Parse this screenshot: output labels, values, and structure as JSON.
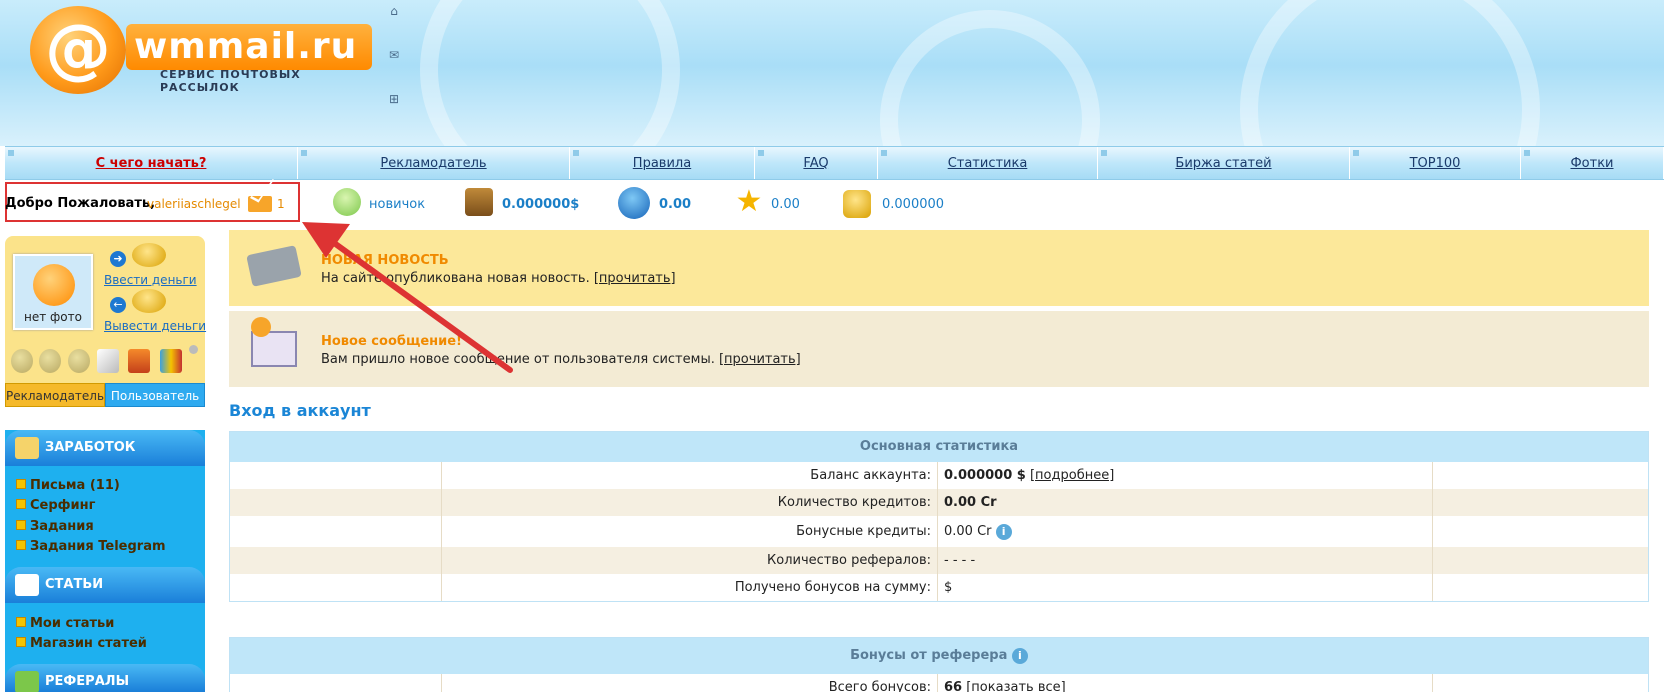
{
  "logo": {
    "at": "@",
    "name": "wmmail.ru",
    "tagline": "СЕРВИС ПОЧТОВЫХ РАССЫЛОК"
  },
  "header_icons": [
    "home-icon",
    "mail-icon",
    "sitemap-icon"
  ],
  "nav": [
    "С чего начать?",
    "Рекламодатель",
    "Правила",
    "FAQ",
    "Статистика",
    "Биржа статей",
    "TOP100",
    "Фотки"
  ],
  "welcome": {
    "text": "Добро Пожаловать,",
    "username": "valeriiaschlegel",
    "messages": "1"
  },
  "stats": {
    "status": "новичок",
    "balance": "0.000000$",
    "credits": "0.00",
    "rating": "0.00",
    "coins": "0.000000"
  },
  "profile": {
    "photo_label": "нет фото",
    "deposit_link": "Ввести деньги",
    "withdraw_link": "Вывести деньги",
    "role_advertiser": "Рекламодатель",
    "role_user": "Пользователь"
  },
  "menu": {
    "earn": {
      "title": "ЗАРАБОТОК",
      "items": [
        "Письма (11)",
        "Серфинг",
        "Задания",
        "Задания Telegram"
      ]
    },
    "articles": {
      "title": "СТАТЬИ",
      "items": [
        "Мои статьи",
        "Магазин статей"
      ]
    },
    "referrals": {
      "title": "РЕФЕРАЛЫ"
    }
  },
  "news": [
    {
      "title": "НОВАЯ НОВОСТЬ",
      "body": "На сайте опубликована новая новость.",
      "link": "[прочитать]"
    },
    {
      "title": "Новое сообщение!",
      "body": "Вам пришло новое сообщение от пользователя системы.",
      "link": "[прочитать]"
    }
  ],
  "account": {
    "title": "Вход в аккаунт",
    "main_stats": {
      "header": "Основная статистика",
      "rows": [
        {
          "label": "Баланс аккаунта:",
          "value": "0.000000 $",
          "link": "[подробнее]"
        },
        {
          "label": "Количество кредитов:",
          "value": "0.00 Cr"
        },
        {
          "label": "Бонусные кредиты:",
          "value": "0.00 Cr"
        },
        {
          "label": "Количество рефералов:",
          "value": "- - - -"
        },
        {
          "label": "Получено бонусов на сумму:",
          "value": "$"
        }
      ]
    },
    "referrer_bonus": {
      "header": "Бонусы от реферера",
      "rows": [
        {
          "label": "Всего бонусов:",
          "value": "66",
          "link": "[показать все]"
        }
      ]
    }
  },
  "colors": {
    "accent_orange": "#f08a00",
    "link_blue": "#1b86d6",
    "alert_red": "#d33"
  }
}
